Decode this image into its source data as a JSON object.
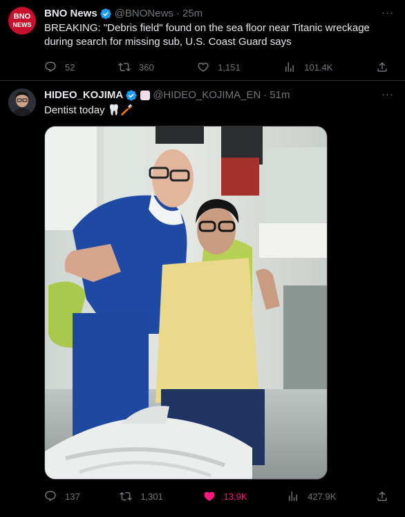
{
  "tweets": [
    {
      "author_name": "BNO News",
      "handle": "@BNONews",
      "dot": "·",
      "time": "25m",
      "text": "BREAKING: \"Debris field\" found on the sea floor near Titanic wreckage during search for missing sub, U.S. Coast Guard says",
      "avatar_text": [
        "BNO",
        "NEWS"
      ],
      "more": "···",
      "replies": "52",
      "retweets": "360",
      "likes": "1,151",
      "views": "101.4K",
      "liked": false
    },
    {
      "author_name": "HIDEO_KOJIMA",
      "handle": "@HIDEO_KOJIMA_EN",
      "dot": "·",
      "time": "51m",
      "text": "Dentist today 🦷🪥",
      "more": "···",
      "replies": "137",
      "retweets": "1,301",
      "likes": "13.9K",
      "views": "427.9K",
      "liked": true
    }
  ],
  "colors": {
    "background": "#000000",
    "text": "#e7e9ea",
    "muted": "#71767b",
    "verified": "#1d9bf0",
    "like_active": "#f91880",
    "bno_red": "#c8102e"
  },
  "icons": [
    "verified-badge-icon",
    "reply-icon",
    "retweet-icon",
    "like-icon",
    "views-icon",
    "share-icon",
    "more-icon",
    "affiliate-badge-icon"
  ]
}
